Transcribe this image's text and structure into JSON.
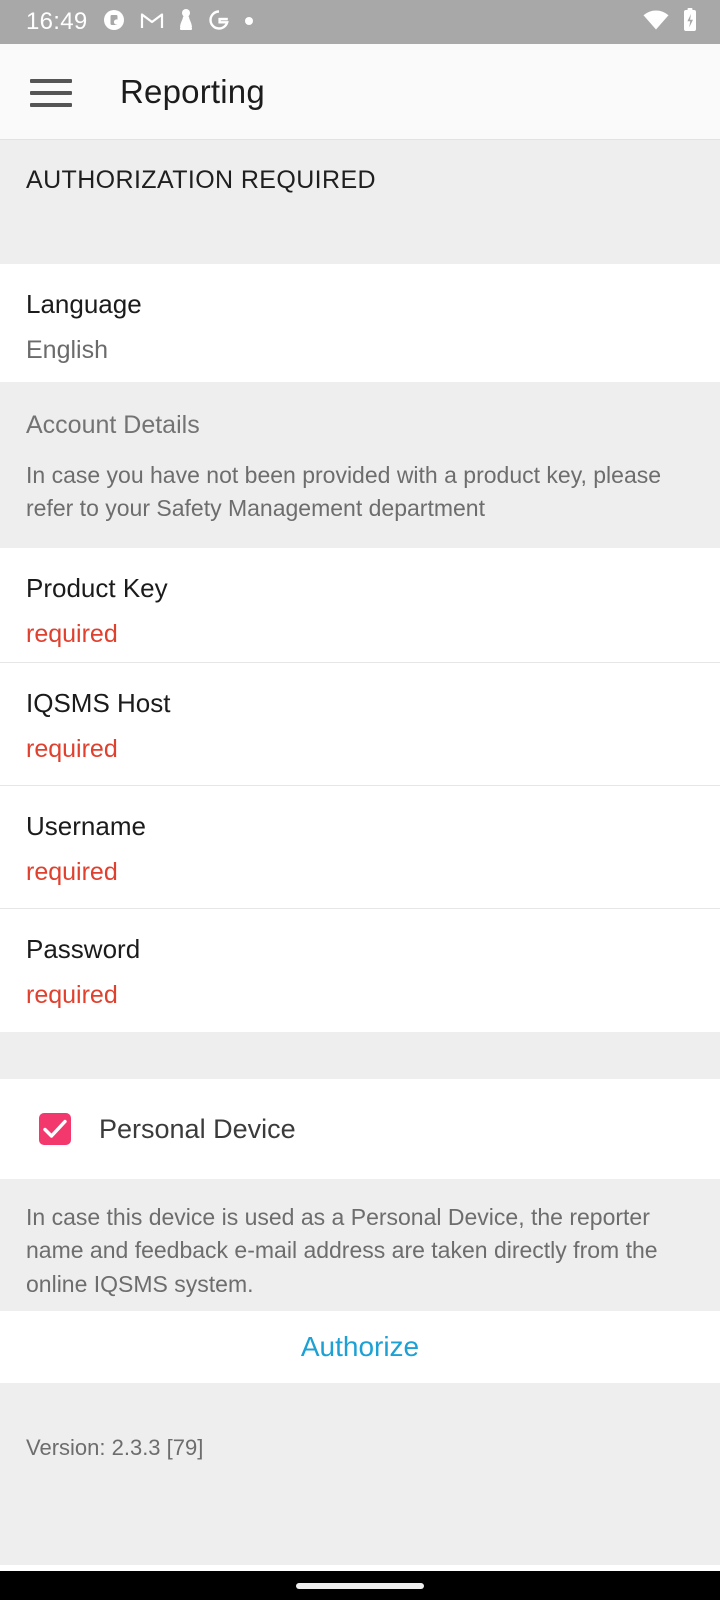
{
  "status_bar": {
    "time": "16:49",
    "left_icons": [
      "app-circle-icon",
      "gmail-icon",
      "chess-pawn-icon",
      "google-g-icon",
      "dot-icon"
    ],
    "right_icons": [
      "wifi-icon",
      "battery-charging-icon"
    ],
    "background_color": "#a8a8a8"
  },
  "app_bar": {
    "menu_icon": "hamburger-menu-icon",
    "title": "Reporting",
    "background_color": "#fafafa"
  },
  "sections": {
    "authorization": {
      "header": "AUTHORIZATION REQUIRED"
    },
    "language": {
      "title": "Language",
      "value": "English"
    },
    "account_details": {
      "title": "Account Details",
      "description": "In case you have not been provided with a product key, please refer to your Safety Management department"
    },
    "fields": [
      {
        "label": "Product Key",
        "value": "required",
        "state": "required"
      },
      {
        "label": "IQSMS Host",
        "value": "required",
        "state": "required"
      },
      {
        "label": "Username",
        "value": "required",
        "state": "required"
      },
      {
        "label": "Password",
        "value": "required",
        "state": "required"
      }
    ],
    "personal_device": {
      "label": "Personal Device",
      "checked": true,
      "checkbox_color": "#f2386c",
      "note": "In case this device is used as a Personal Device, the reporter name and feedback e-mail address are taken directly from the online IQSMS system."
    },
    "authorize": {
      "label": "Authorize",
      "color": "#1da1d4"
    },
    "footer": {
      "version": "Version: 2.3.3 [79]"
    }
  },
  "nav_bar": {
    "gesture_pill": "home-gesture-pill",
    "background_color": "#000000"
  },
  "colors": {
    "required_red": "#e0412f",
    "accent_blue": "#1da1d4",
    "accent_pink": "#f2386c",
    "band_grey": "#eeeeee"
  }
}
